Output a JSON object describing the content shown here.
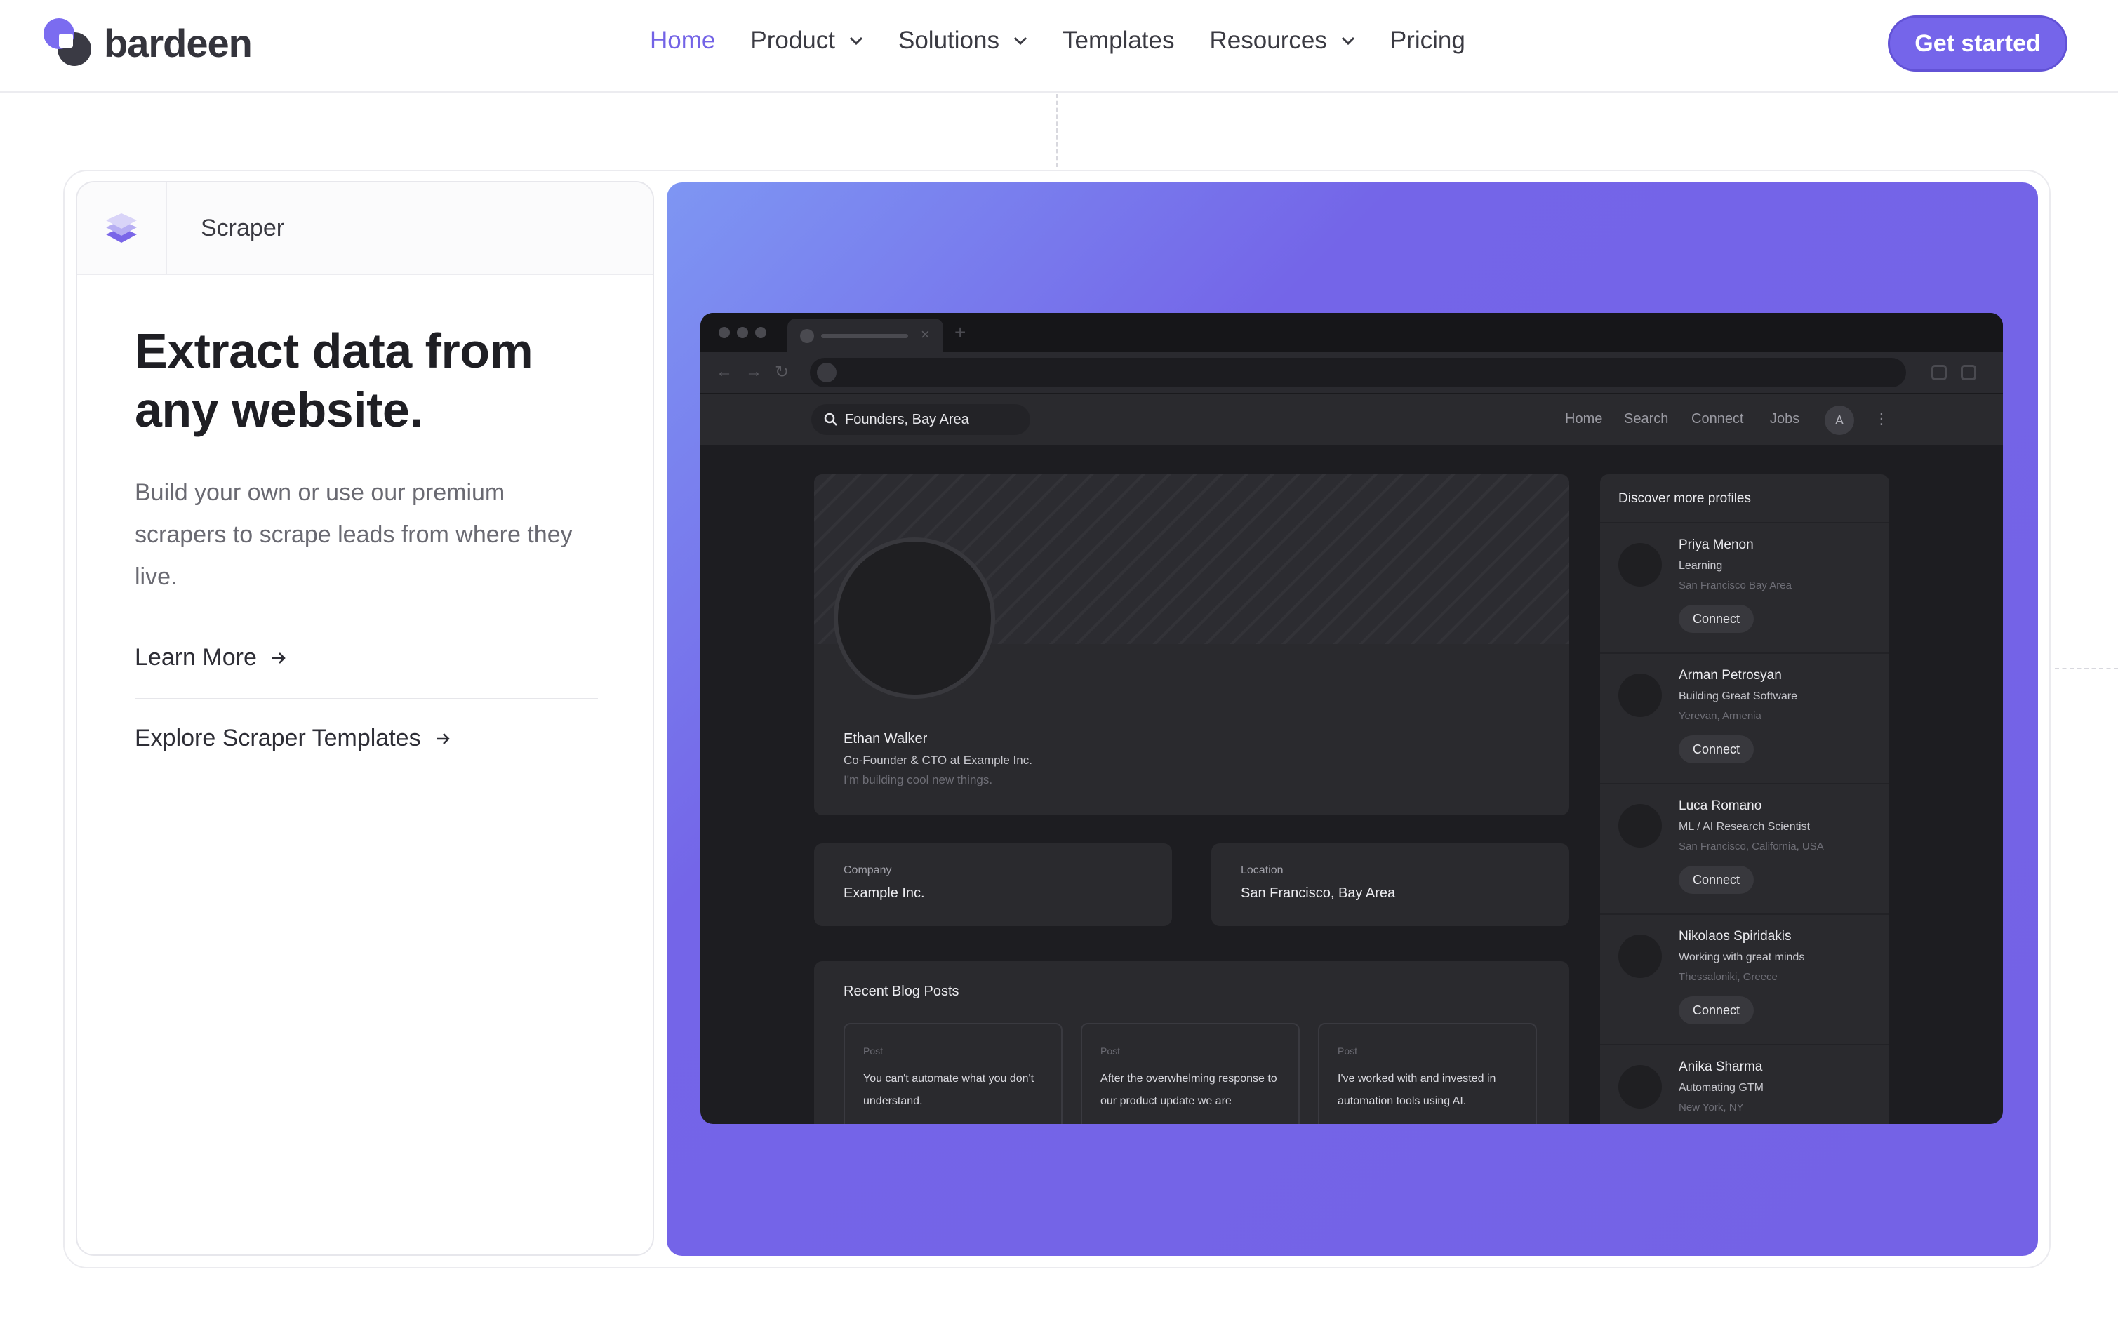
{
  "brand": {
    "name": "bardeen"
  },
  "nav": {
    "items": [
      {
        "label": "Home",
        "active": true,
        "dropdown": false
      },
      {
        "label": "Product",
        "dropdown": true
      },
      {
        "label": "Solutions",
        "dropdown": true
      },
      {
        "label": "Templates",
        "dropdown": false
      },
      {
        "label": "Resources",
        "dropdown": true
      },
      {
        "label": "Pricing",
        "dropdown": false
      }
    ],
    "cta": "Get started"
  },
  "feature": {
    "tab_label": "Scraper",
    "headline_line1": "Extract data from",
    "headline_line2": "any website.",
    "description": "Build your own or use our premium scrapers to scrape leads from where they live.",
    "links": [
      "Learn More",
      "Explore Scraper Templates"
    ]
  },
  "mock": {
    "search": "Founders, Bay Area",
    "nav": [
      "Home",
      "Search",
      "Connect",
      "Jobs"
    ],
    "avatar_initial": "A",
    "profile": {
      "name": "Ethan Walker",
      "title": "Co-Founder & CTO at Example Inc.",
      "bio": "I'm building cool new things."
    },
    "company": {
      "label": "Company",
      "value": "Example Inc."
    },
    "location": {
      "label": "Location",
      "value": "San Francisco, Bay Area"
    },
    "blog": {
      "title": "Recent Blog Posts",
      "posts": [
        {
          "label": "Post",
          "text": "You can't automate what you don't understand."
        },
        {
          "label": "Post",
          "text": "After the overwhelming response to our product update we are"
        },
        {
          "label": "Post",
          "text": "I've worked with and invested in automation tools using AI."
        }
      ]
    },
    "sidebar": {
      "title": "Discover more profiles",
      "connect_label": "Connect",
      "profiles": [
        {
          "name": "Priya Menon",
          "role": "Learning",
          "location": "San Francisco Bay Area"
        },
        {
          "name": "Arman Petrosyan",
          "role": "Building Great Software",
          "location": "Yerevan, Armenia"
        },
        {
          "name": "Luca Romano",
          "role": "ML / AI Research Scientist",
          "location": "San Francisco, California, USA"
        },
        {
          "name": "Nikolaos Spiridakis",
          "role": "Working with great minds",
          "location": "Thessaloniki, Greece"
        },
        {
          "name": "Anika Sharma",
          "role": "Automating GTM",
          "location": "New York, NY"
        }
      ]
    }
  },
  "colors": {
    "accent": "#7363e6",
    "cta": "#7565ea",
    "panel_gradient_start": "#7e96f3",
    "panel_gradient_end": "#7462e6",
    "mock_bg": "#1d1d21"
  },
  "icons": {
    "logo": "bardeen-logo-icon",
    "dropdown": "chevron-down-icon",
    "feature": "layers-icon",
    "link_arrow": "arrow-right-icon",
    "search": "search-icon"
  }
}
